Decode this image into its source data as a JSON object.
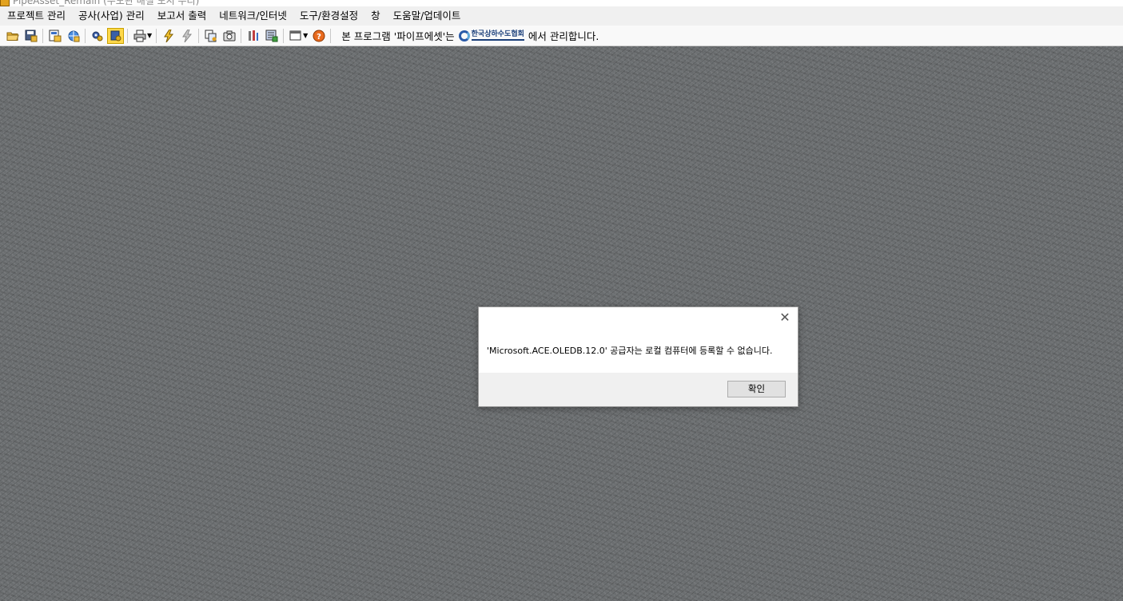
{
  "window": {
    "title": "PipeAsset_Remain (수도관 매설 도시 수리)"
  },
  "menu": [
    "프로젝트 관리",
    "공사(사업) 관리",
    "보고서 출력",
    "네트워크/인터넷",
    "도구/환경설정",
    "창",
    "도움말/업데이트"
  ],
  "toolbar": {
    "notice_prefix": "본 프로그램 '파이프에셋'는",
    "notice_suffix": "에서 관리합니다.",
    "logo_text": "한국상하수도협회",
    "icons": [
      "open-folder-icon",
      "save-icon",
      "project-icon",
      "network-icon",
      "gear-settings-icon",
      "active-tool-icon",
      "print-icon",
      "lightning-icon",
      "lightning-gray-icon",
      "copy-icon",
      "camera-icon",
      "tools-icon",
      "report-icon",
      "window-icon",
      "help-icon"
    ]
  },
  "dialog": {
    "message": "'Microsoft.ACE.OLEDB.12.0' 공급자는 로컬 컴퓨터에 등록할 수 없습니다.",
    "ok_label": "확인",
    "close_symbol": "✕"
  },
  "colors": {
    "background": "#6b6e70",
    "toolbar_active": "#ffd84a",
    "logo": "#1b3f7a"
  }
}
